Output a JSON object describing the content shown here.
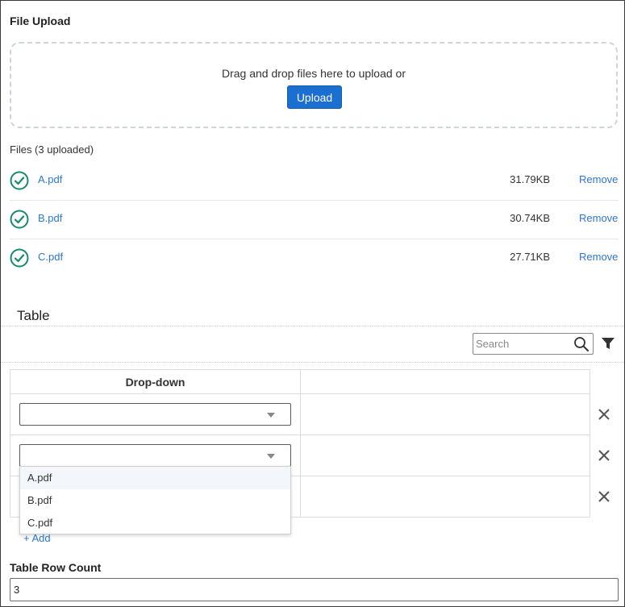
{
  "file_upload": {
    "title": "File Upload",
    "dropzone_text": "Drag and drop files here to upload or",
    "upload_label": "Upload",
    "files_label": "Files (3 uploaded)",
    "files": [
      {
        "name": "A.pdf",
        "size": "31.79KB",
        "action": "Remove",
        "status_icon": "check-circle-icon"
      },
      {
        "name": "B.pdf",
        "size": "30.74KB",
        "action": "Remove",
        "status_icon": "check-circle-icon"
      },
      {
        "name": "C.pdf",
        "size": "27.71KB",
        "action": "Remove",
        "status_icon": "check-circle-icon"
      }
    ]
  },
  "table": {
    "title": "Table",
    "search_placeholder": "Search",
    "columns": [
      "Drop-down",
      ""
    ],
    "rows": [
      {
        "dropdown_value": ""
      },
      {
        "dropdown_value": ""
      },
      {
        "dropdown_value": ""
      }
    ],
    "open_dropdown_options": [
      "A.pdf",
      "B.pdf",
      "C.pdf"
    ],
    "add_label": "+ Add"
  },
  "row_count": {
    "label": "Table Row Count",
    "value": "3"
  },
  "colors": {
    "accent": "#1b6fd1",
    "link": "#2b78d0",
    "success": "#1a8a6e"
  }
}
